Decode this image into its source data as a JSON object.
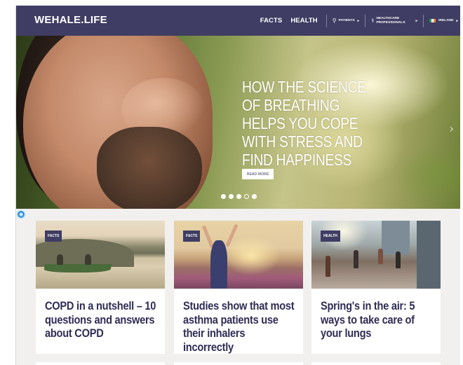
{
  "header": {
    "logo": "WEHALE.LIFE",
    "nav": {
      "facts": "FACTS",
      "health": "HEALTH",
      "patients": "PATIENTS",
      "healthcare": "HEALTHCARE PROFESSIONALS",
      "country": "IRELAND"
    }
  },
  "hero": {
    "title": "HOW THE SCIENCE OF BREATHING HELPS YOU COPE WITH STRESS AND FIND HAPPINESS",
    "read_more": "READ MORE",
    "slides_total": 5,
    "active_slide": 3
  },
  "cards": [
    {
      "tag": "FACTS",
      "title": "COPD in a nutshell – 10 questions and answers about COPD"
    },
    {
      "tag": "FACTS",
      "title": "Studies show that most asthma patients use their inhalers incorrectly"
    },
    {
      "tag": "HEALTH",
      "title": "Spring's in the air: 5 ways to take care of your lungs"
    }
  ],
  "colors": {
    "brand": "#3f3d63",
    "title_text": "#2f2d55",
    "widget": "#2f8fd8"
  },
  "icons": {
    "patients": "person-icon",
    "healthcare": "stethoscope-icon",
    "country": "ireland-flag-icon",
    "hero_next": "chevron-right-icon"
  }
}
